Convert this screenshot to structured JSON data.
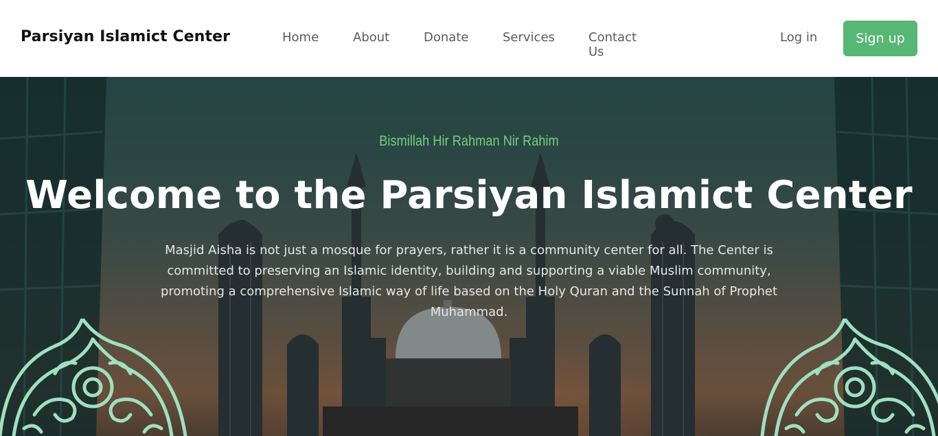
{
  "header": {
    "brand": "Parsiyan Islamict Center",
    "nav": [
      {
        "label": "Home"
      },
      {
        "label": "About"
      },
      {
        "label": "Donate"
      },
      {
        "label": "Services"
      },
      {
        "label": "Contact Us"
      }
    ],
    "login_label": "Log in",
    "signup_label": "Sign up"
  },
  "hero": {
    "tagline": "Bismillah Hir Rahman Nir Rahim",
    "title": "Welcome to the Parsiyan Islamict Center",
    "description": "Masjid Aisha is not just a mosque for prayers, rather it is a community center for all. The Center is committed to preserving an Islamic identity, building and supporting a viable Muslim community, promoting a comprehensive Islamic way of life based on the Holy Quran and the Sunnah of Prophet Muhammad."
  },
  "colors": {
    "accent": "#57b774",
    "tagline": "#6fd37e",
    "ornament": "#9fe0c0"
  },
  "icons": [
    "arabesque-ornament-left",
    "arabesque-ornament-right",
    "mosque-silhouette"
  ]
}
